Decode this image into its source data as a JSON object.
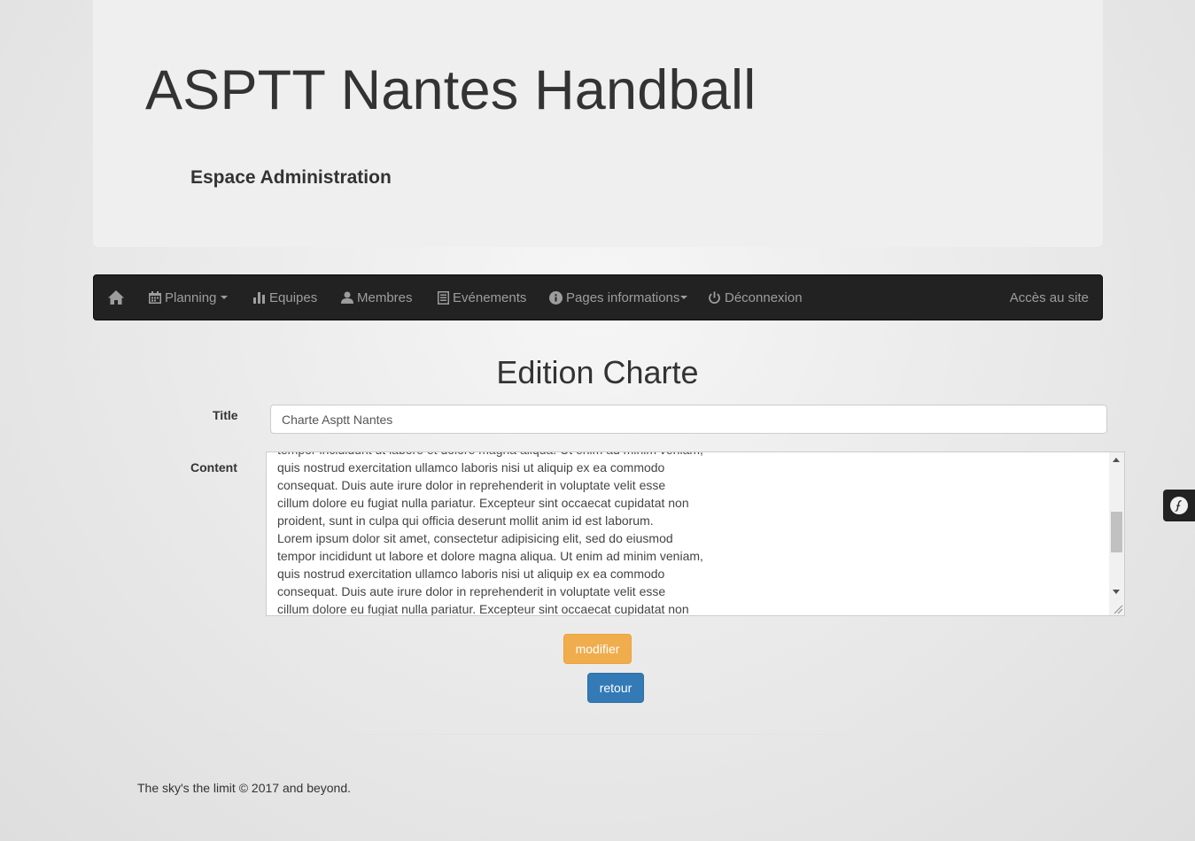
{
  "header": {
    "title": "ASPTT Nantes Handball",
    "subtitle": "Espace Administration"
  },
  "navbar": {
    "items": [
      {
        "label": "Planning",
        "icon": "calendar-icon",
        "dropdown": true
      },
      {
        "label": "Equipes",
        "icon": "bar-chart-icon",
        "dropdown": false
      },
      {
        "label": "Membres",
        "icon": "user-icon",
        "dropdown": false
      },
      {
        "label": "Evénements",
        "icon": "list-icon",
        "dropdown": false
      },
      {
        "label": "Pages informations",
        "icon": "info-circle-icon",
        "dropdown": true
      },
      {
        "label": "Déconnexion",
        "icon": "power-icon",
        "dropdown": false
      }
    ],
    "right_link": "Accès au site",
    "home_icon": "home-icon"
  },
  "page": {
    "heading": "Edition Charte"
  },
  "form": {
    "title_label": "Title",
    "title_value": "Charte Asptt Nantes",
    "content_label": "Content",
    "content_value": "tempor incididunt ut labore et dolore magna aliqua. Ut enim ad minim veniam,\nquis nostrud exercitation ullamco laboris nisi ut aliquip ex ea commodo\nconsequat. Duis aute irure dolor in reprehenderit in voluptate velit esse\ncillum dolore eu fugiat nulla pariatur. Excepteur sint occaecat cupidatat non\nproident, sunt in culpa qui officia deserunt mollit anim id est laborum.\nLorem ipsum dolor sit amet, consectetur adipisicing elit, sed do eiusmod\ntempor incididunt ut labore et dolore magna aliqua. Ut enim ad minim veniam,\nquis nostrud exercitation ullamco laboris nisi ut aliquip ex ea commodo\nconsequat. Duis aute irure dolor in reprehenderit in voluptate velit esse\ncillum dolore eu fugiat nulla pariatur. Excepteur sint occaecat cupidatat non",
    "submit_label": "modifier",
    "back_label": "retour"
  },
  "footer": {
    "text": "The sky's the limit © 2017 and beyond."
  },
  "colors": {
    "navbar_bg": "#222222",
    "navbar_text": "#9d9d9d",
    "warning": "#f0ad4e",
    "primary": "#337ab7"
  },
  "symfony_toolbar_icon": "symfony-logo-icon"
}
